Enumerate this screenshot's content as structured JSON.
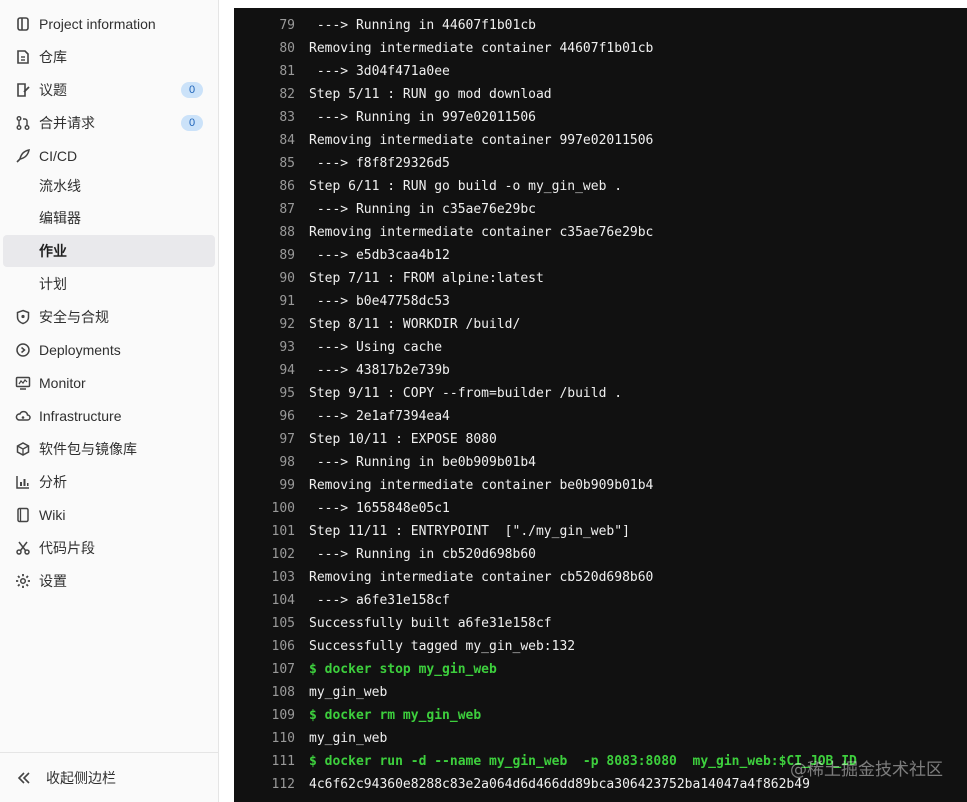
{
  "sidebar": {
    "items": [
      {
        "label": "Project information",
        "icon": "project-icon"
      },
      {
        "label": "仓库",
        "icon": "doc-icon"
      },
      {
        "label": "议题",
        "icon": "issues-icon",
        "badge": "0"
      },
      {
        "label": "合并请求",
        "icon": "merge-request-icon",
        "badge": "0"
      },
      {
        "label": "CI/CD",
        "icon": "rocket-icon"
      },
      {
        "label": "流水线"
      },
      {
        "label": "编辑器"
      },
      {
        "label": "作业",
        "active": true
      },
      {
        "label": "计划"
      },
      {
        "label": "安全与合规",
        "icon": "shield-icon"
      },
      {
        "label": "Deployments",
        "icon": "deployments-icon"
      },
      {
        "label": "Monitor",
        "icon": "monitor-icon"
      },
      {
        "label": "Infrastructure",
        "icon": "cloud-icon"
      },
      {
        "label": "软件包与镜像库",
        "icon": "package-icon"
      },
      {
        "label": "分析",
        "icon": "chart-icon"
      },
      {
        "label": "Wiki",
        "icon": "book-icon"
      },
      {
        "label": "代码片段",
        "icon": "scissors-icon"
      },
      {
        "label": "设置",
        "icon": "gear-icon"
      }
    ],
    "collapse_label": "收起侧边栏"
  },
  "log": {
    "lines": [
      {
        "num": "79",
        "text": " ---> Running in 44607f1b01cb"
      },
      {
        "num": "80",
        "text": "Removing intermediate container 44607f1b01cb"
      },
      {
        "num": "81",
        "text": " ---> 3d04f471a0ee"
      },
      {
        "num": "82",
        "text": "Step 5/11 : RUN go mod download"
      },
      {
        "num": "83",
        "text": " ---> Running in 997e02011506"
      },
      {
        "num": "84",
        "text": "Removing intermediate container 997e02011506"
      },
      {
        "num": "85",
        "text": " ---> f8f8f29326d5"
      },
      {
        "num": "86",
        "text": "Step 6/11 : RUN go build -o my_gin_web ."
      },
      {
        "num": "87",
        "text": " ---> Running in c35ae76e29bc"
      },
      {
        "num": "88",
        "text": "Removing intermediate container c35ae76e29bc"
      },
      {
        "num": "89",
        "text": " ---> e5db3caa4b12"
      },
      {
        "num": "90",
        "text": "Step 7/11 : FROM alpine:latest"
      },
      {
        "num": "91",
        "text": " ---> b0e47758dc53"
      },
      {
        "num": "92",
        "text": "Step 8/11 : WORKDIR /build/"
      },
      {
        "num": "93",
        "text": " ---> Using cache"
      },
      {
        "num": "94",
        "text": " ---> 43817b2e739b"
      },
      {
        "num": "95",
        "text": "Step 9/11 : COPY --from=builder /build ."
      },
      {
        "num": "96",
        "text": " ---> 2e1af7394ea4"
      },
      {
        "num": "97",
        "text": "Step 10/11 : EXPOSE 8080"
      },
      {
        "num": "98",
        "text": " ---> Running in be0b909b01b4"
      },
      {
        "num": "99",
        "text": "Removing intermediate container be0b909b01b4"
      },
      {
        "num": "100",
        "text": " ---> 1655848e05c1"
      },
      {
        "num": "101",
        "text": "Step 11/11 : ENTRYPOINT  [\"./my_gin_web\"]"
      },
      {
        "num": "102",
        "text": " ---> Running in cb520d698b60"
      },
      {
        "num": "103",
        "text": "Removing intermediate container cb520d698b60"
      },
      {
        "num": "104",
        "text": " ---> a6fe31e158cf"
      },
      {
        "num": "105",
        "text": "Successfully built a6fe31e158cf"
      },
      {
        "num": "106",
        "text": "Successfully tagged my_gin_web:132"
      },
      {
        "num": "107",
        "text": "$ docker stop my_gin_web",
        "cmd": true
      },
      {
        "num": "108",
        "text": "my_gin_web"
      },
      {
        "num": "109",
        "text": "$ docker rm my_gin_web",
        "cmd": true
      },
      {
        "num": "110",
        "text": "my_gin_web"
      },
      {
        "num": "111",
        "text": "$ docker run -d --name my_gin_web  -p 8083:8080  my_gin_web:$CI_JOB_ID",
        "cmd": true
      },
      {
        "num": "112",
        "text": "4c6f62c94360e8288c83e2a064d6d466dd89bca306423752ba14047a4f862b49"
      }
    ]
  },
  "watermark": "@稀土掘金技术社区",
  "colors": {
    "command": "#3dcf3d",
    "log_background": "#111111",
    "badge": "#cbe2f9"
  }
}
